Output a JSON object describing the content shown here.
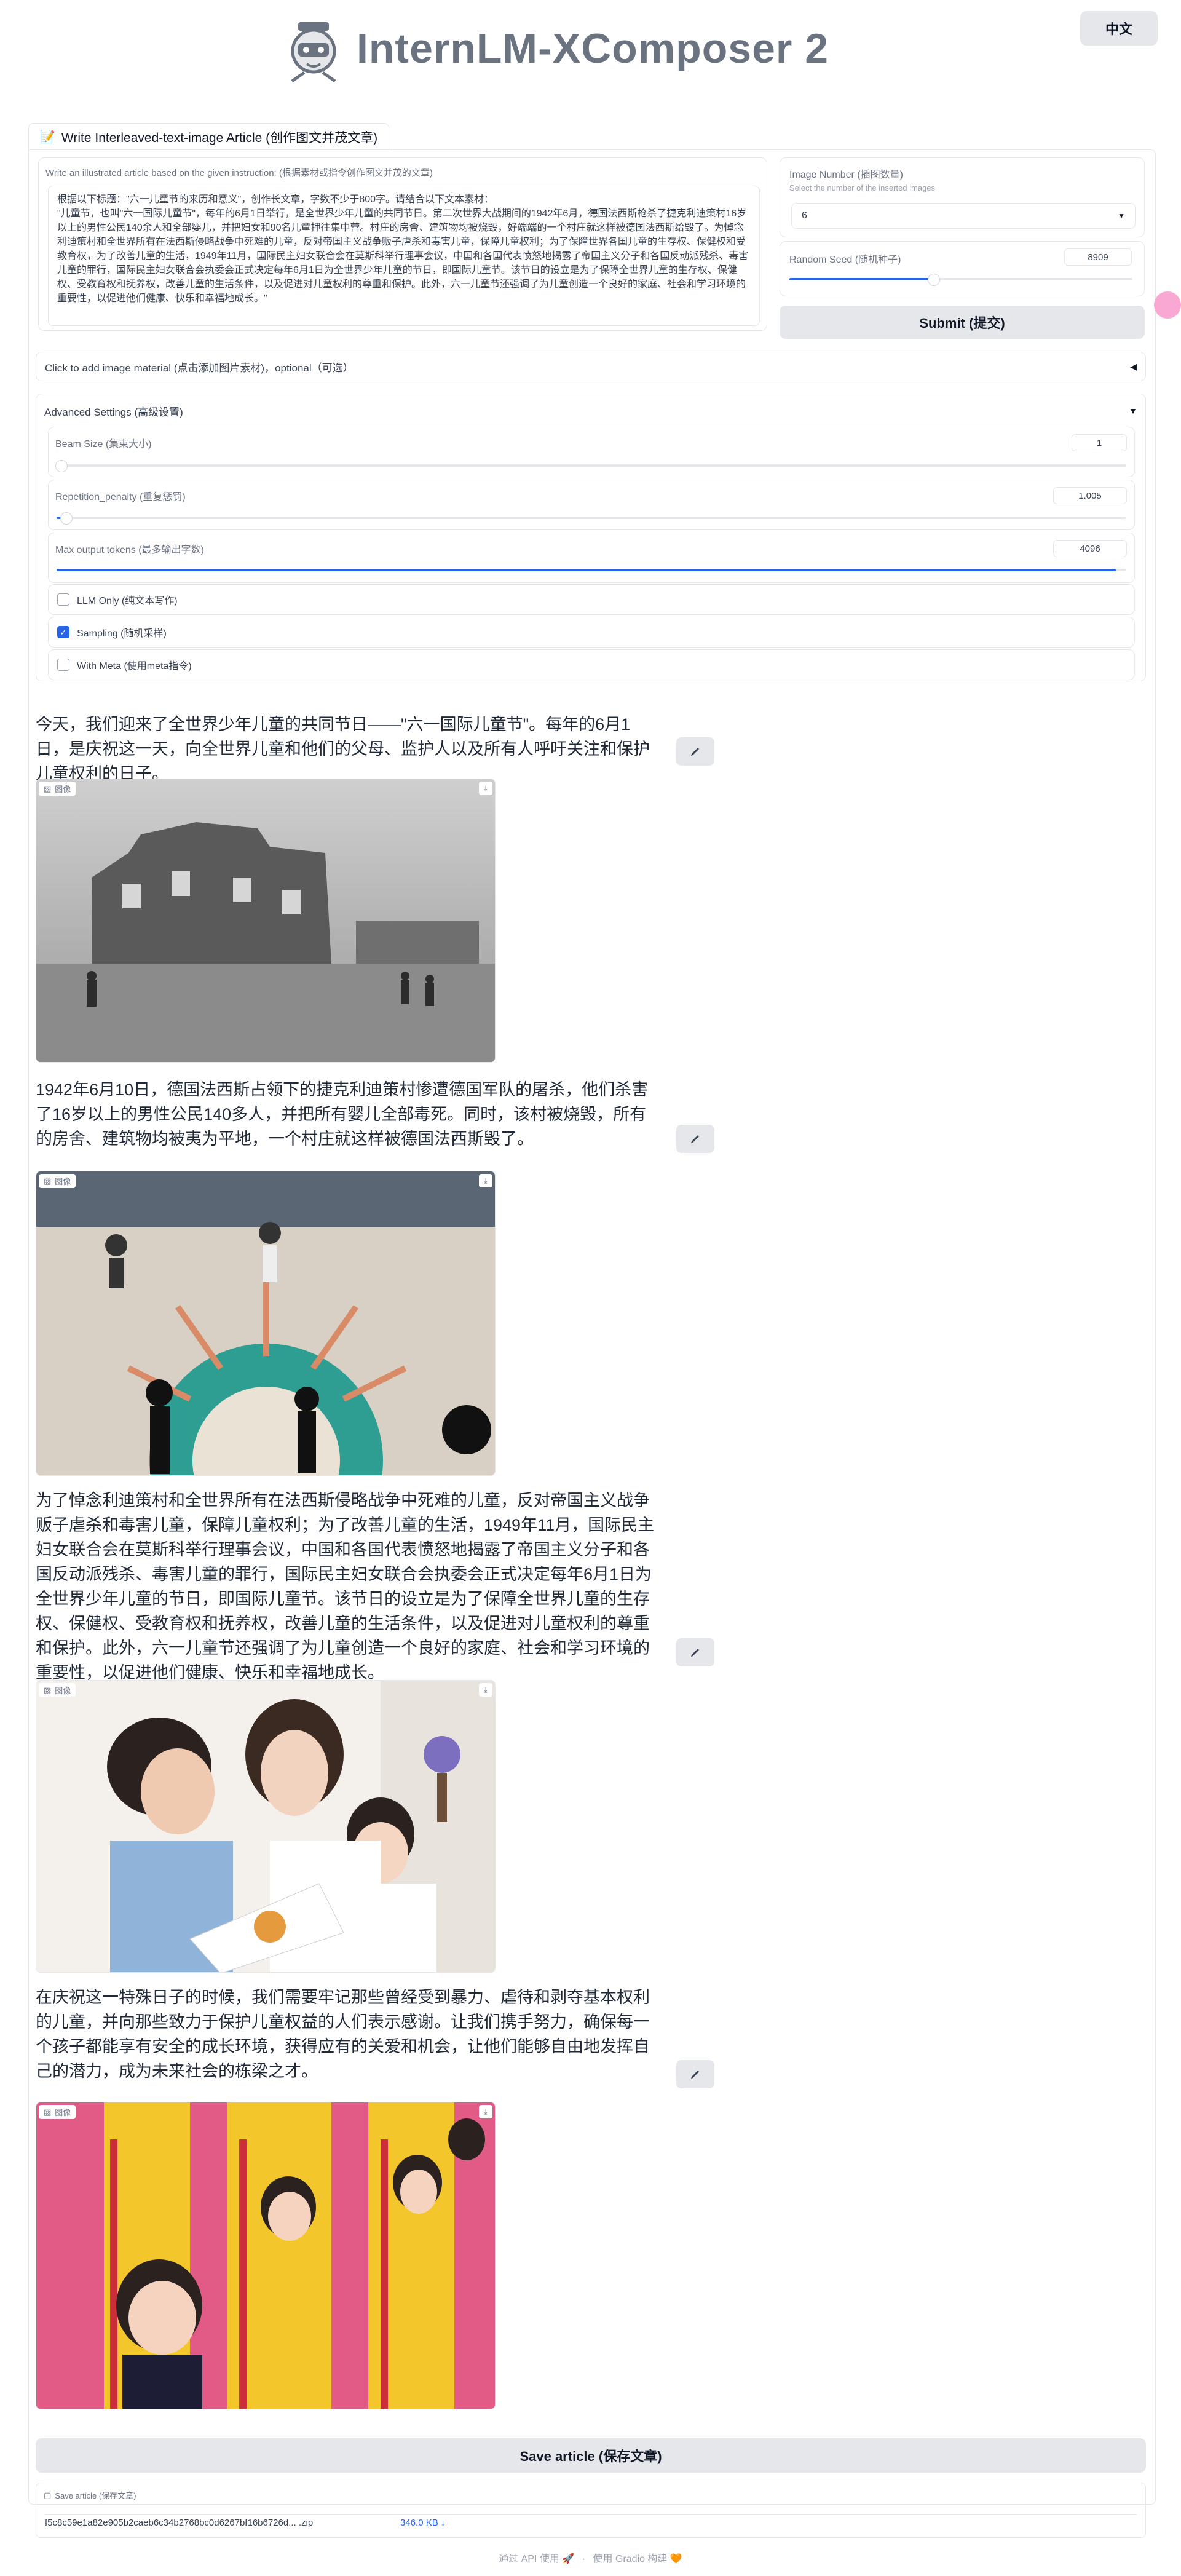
{
  "header": {
    "lang_button": "中文",
    "title": "InternLM-XComposer 2",
    "logo_icon": "robot-mascot-icon"
  },
  "tabs": [
    {
      "label": "Write Interleaved-text-image Article (创作图文并茂文章)",
      "icon": "memo-icon"
    }
  ],
  "instruction": {
    "label": "Write an illustrated article based on the given instruction: (根据素材或指令创作图文并茂的文章)",
    "value": "根据以下标题：\"六一儿童节的来历和意义\"，创作长文章，字数不少于800字。请结合以下文本素材：\n\"儿童节，也叫\"六一国际儿童节\"，每年的6月1日举行，是全世界少年儿童的共同节日。第二次世界大战期间的1942年6月，德国法西斯枪杀了捷克利迪策村16岁以上的男性公民140余人和全部婴儿，并把妇女和90名儿童押往集中营。村庄的房舍、建筑物均被烧毁，好端端的一个村庄就这样被德国法西斯给毁了。为悼念利迪策村和全世界所有在法西斯侵略战争中死难的儿童，反对帝国主义战争贩子虐杀和毒害儿童，保障儿童权利；为了保障世界各国儿童的生存权、保健权和受教育权，为了改善儿童的生活，1949年11月，国际民主妇女联合会在莫斯科举行理事会议，中国和各国代表愤怒地揭露了帝国主义分子和各国反动派残杀、毒害儿童的罪行，国际民主妇女联合会执委会正式决定每年6月1日为全世界少年儿童的节日，即国际儿童节。该节日的设立是为了保障全世界儿童的生存权、保健权、受教育权和抚养权，改善儿童的生活条件，以及促进对儿童权利的尊重和保护。此外，六一儿童节还强调了为儿童创造一个良好的家庭、社会和学习环境的重要性，以促进他们健康、快乐和幸福地成长。\""
  },
  "image_number": {
    "label": "Image Number (插图数量)",
    "sublabel": "Select the number of the inserted images",
    "value": "6",
    "chevron_icon": "chevron-down-icon"
  },
  "random_seed": {
    "label": "Random Seed (随机种子)",
    "value": "8909",
    "level": 0.42
  },
  "submit": {
    "label": "Submit (提交)"
  },
  "image_material": {
    "label": "Click to add image material (点击添加图片素材)，optional（可选）",
    "arrow_icon": "caret-left-icon"
  },
  "advanced": {
    "label": "Advanced Settings (高级设置)",
    "arrow_icon": "caret-down-icon",
    "beam_size": {
      "label": "Beam Size (集束大小)",
      "value": "1",
      "level": 0.0
    },
    "repetition_penalty": {
      "label": "Repetition_penalty (重复惩罚)",
      "value": "1.005",
      "level": 0.01
    },
    "max_tokens": {
      "label": "Max output tokens (最多输出字数)",
      "value": "4096",
      "level": 0.99
    },
    "checkboxes": [
      {
        "label": "LLM Only (纯文本写作)",
        "checked": false
      },
      {
        "label": "Sampling (随机采样)",
        "checked": true
      },
      {
        "label": "With Meta (使用meta指令)",
        "checked": false
      }
    ]
  },
  "article": {
    "image_tag": "图像",
    "paragraphs": [
      "今天，我们迎来了全世界少年儿童的共同节日——\"六一国际儿童节\"。每年的6月1日，是庆祝这一天，向全世界儿童和他们的父母、监护人以及所有人呼吁关注和保护儿童权利的日子。",
      "1942年6月10日，德国法西斯占领下的捷克利迪策村惨遭德国军队的屠杀，他们杀害了16岁以上的男性公民140多人，并把所有婴儿全部毒死。同时，该村被烧毁，所有的房舍、建筑物均被夷为平地，一个村庄就这样被德国法西斯毁了。",
      "为了悼念利迪策村和全世界所有在法西斯侵略战争中死难的儿童，反对帝国主义战争贩子虐杀和毒害儿童，保障儿童权利；为了改善儿童的生活，1949年11月，国际民主妇女联合会在莫斯科举行理事会议，中国和各国代表愤怒地揭露了帝国主义分子和各国反动派残杀、毒害儿童的罪行，国际民主妇女联合会执委会正式决定每年6月1日为全世界少年儿童的节日，即国际儿童节。该节日的设立是为了保障全世界儿童的生存权、保健权、受教育权和抚养权，改善儿童的生活条件，以及促进对儿童权利的尊重和保护。此外，六一儿童节还强调了为儿童创造一个良好的家庭、社会和学习环境的重要性，以促进他们健康、快乐和幸福地成长。",
      "在庆祝这一特殊日子的时候，我们需要牢记那些曾经受到暴力、虐待和剥夺基本权利的儿童，并向那些致力于保护儿童权益的人们表示感谢。让我们携手努力，确保每一个孩子都能享有安全的成长环境，获得应有的关爱和机会，让他们能够自由地发挥自己的潜力，成为未来社会的栋梁之才。"
    ]
  },
  "save": {
    "label": "Save article (保存文章)"
  },
  "file": {
    "label": "Save article (保存文章)",
    "name": "f5c8c59e1a82e905b2caeb6c34b2768bc0d6267bf16b6726d... .zip",
    "size": "346.0 KB ↓"
  },
  "footer": {
    "api_text": "通过 API 使用",
    "separator": "·",
    "built_text": "使用 Gradio 构建"
  }
}
